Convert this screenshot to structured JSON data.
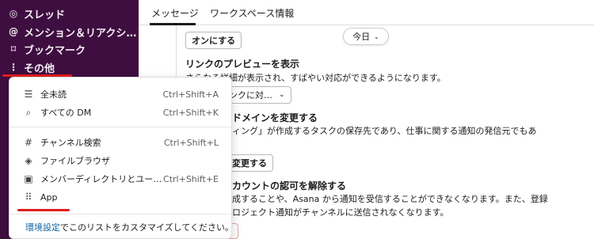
{
  "sidebar": {
    "items": [
      {
        "icon": "threads-icon",
        "glyph": "◎",
        "label": "スレッド"
      },
      {
        "icon": "mention-icon",
        "glyph": "@",
        "label": "メンション＆リアクシ…"
      },
      {
        "icon": "bookmark-icon",
        "glyph": "⌑",
        "label": "ブックマーク"
      },
      {
        "icon": "more-icon",
        "glyph": "⋮",
        "label": "その他"
      }
    ]
  },
  "tabs": [
    {
      "label": "メッセージ",
      "active": true
    },
    {
      "label": "ワークスペース情報",
      "active": false
    }
  ],
  "top_partial_text": "",
  "toolbar": {
    "enable_button": "オンにする",
    "today_button": "今日",
    "link_dropdown": "ンクに対…",
    "change_button": "変更する"
  },
  "sections": {
    "link_preview_heading": "リンクのプレビューを表示",
    "link_preview_desc": "さらなる詳細が表示され、すばやい対応ができるようになります。",
    "domain_heading": "ドメインを変更する",
    "domain_desc": "ィング」が作成するタスクの保存先であり、仕事に関する通知の発信元でもあ",
    "revoke_heading": "カウントの認可を解除する",
    "revoke_desc1": "成することや、Asana から通知を受信することができなくなります。また、登録",
    "revoke_desc2": "ロジェクト通知がチャンネルに送信されなくなります。"
  },
  "menu": {
    "items": [
      {
        "icon": "all-unread-icon",
        "glyph": "☰",
        "label": "全未読",
        "shortcut": "Ctrl+Shift+A"
      },
      {
        "icon": "dm-icon",
        "glyph": "⌕",
        "label": "すべての DM",
        "shortcut": "Ctrl+Shift+K"
      },
      {
        "icon": "channel-search-icon",
        "glyph": "#",
        "label": "チャンネル検索",
        "shortcut": "Ctrl+Shift+L"
      },
      {
        "icon": "file-browser-icon",
        "glyph": "◈",
        "label": "ファイルブラウザ",
        "shortcut": ""
      },
      {
        "icon": "member-directory-icon",
        "glyph": "▣",
        "label": "メンバーディレクトリとユー…",
        "shortcut": "Ctrl+Shift+E"
      },
      {
        "icon": "apps-icon",
        "glyph": "⠿",
        "label": "App",
        "shortcut": ""
      }
    ],
    "footer_link": "環境設定",
    "footer_text": "でこのリストをカスタマイズしてください。"
  },
  "colors": {
    "sidebar_bg": "#3f0e40",
    "link": "#1264a3",
    "highlight": "#e01e1e"
  }
}
